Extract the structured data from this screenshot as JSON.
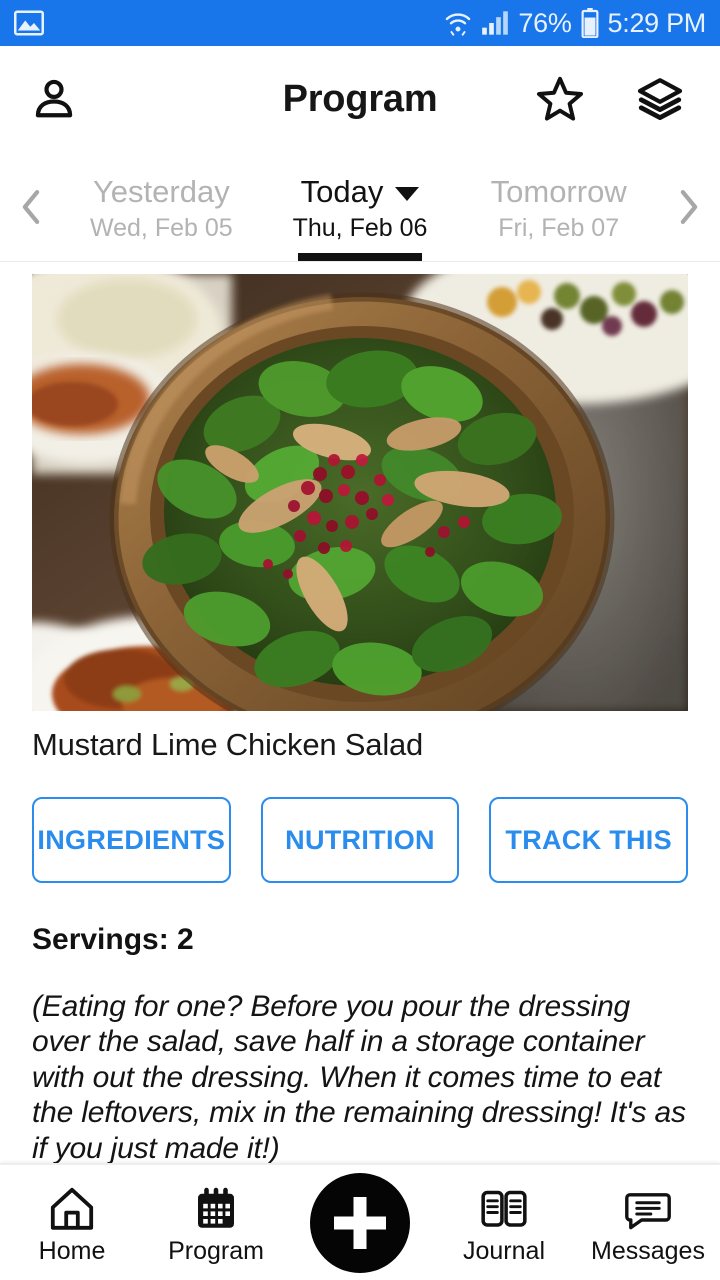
{
  "status_bar": {
    "background": "#1976ea",
    "left_icon": "photo-icon",
    "icons": [
      "wifi-icon",
      "cellular-signal-icon",
      "battery-icon"
    ],
    "battery_percent": "76%",
    "time": "5:29 PM"
  },
  "app_bar": {
    "profile_icon": "person-icon",
    "title": "Program",
    "favorite_icon": "star-outline-icon",
    "layers_icon": "layers-icon"
  },
  "day_selector": {
    "prev_arrow": "chevron-left-icon",
    "next_arrow": "chevron-right-icon",
    "dropdown_icon": "caret-down-icon",
    "days": [
      {
        "name": "Yesterday",
        "date": "Wed, Feb 05",
        "active": false
      },
      {
        "name": "Today",
        "date": "Thu, Feb 06",
        "active": true
      },
      {
        "name": "Tomorrow",
        "date": "Fri, Feb 07",
        "active": false
      }
    ]
  },
  "meal": {
    "photo_alt": "spinach-chicken-salad-photo",
    "title": "Mustard Lime Chicken Salad",
    "actions": [
      {
        "label": "INGREDIENTS",
        "name": "ingredients-button"
      },
      {
        "label": "NUTRITION",
        "name": "nutrition-button"
      },
      {
        "label": "TRACK THIS",
        "name": "track-this-button"
      }
    ],
    "servings_label": "Servings: 2",
    "note": "(Eating for one? Before you pour the dressing over the salad, save half in a storage container with out the dressing. When it comes time to eat the leftovers, mix in the remaining dressing! It's as if you just made it!)"
  },
  "bottom_nav": {
    "items": [
      {
        "label": "Home",
        "icon": "home-icon"
      },
      {
        "label": "Program",
        "icon": "calendar-icon"
      },
      {
        "label": "Journal",
        "icon": "book-icon"
      },
      {
        "label": "Messages",
        "icon": "message-bubble-icon"
      }
    ],
    "fab": {
      "icon": "plus-icon"
    }
  },
  "colors": {
    "status_bar": "#1976ea",
    "accent_blue": "#2a8ded",
    "text_primary": "#121212",
    "text_muted": "#b3b3b3"
  }
}
